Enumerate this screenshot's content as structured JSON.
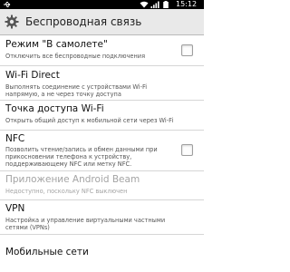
{
  "status_bar": {
    "time": "15:12",
    "icons": [
      "usb-icon",
      "wifi-icon",
      "signal-icon",
      "battery-icon"
    ]
  },
  "header": {
    "title": "Беспроводная связь",
    "icon": "gear-icon"
  },
  "settings": [
    {
      "title": "Режим \"В самолете\"",
      "summary": "Отключить все беспроводные подключения",
      "checkbox": true,
      "checked": false,
      "enabled": true
    },
    {
      "title": "Wi-Fi Direct",
      "summary": "Выполнять соединение  с устройствами Wi-Fi напрямую, а не через точку доступа",
      "checkbox": false,
      "enabled": true
    },
    {
      "title": "Точка доступа Wi-Fi",
      "summary": "Открыть общий доступ к мобильной сети через Wi-Fi",
      "checkbox": false,
      "enabled": true
    },
    {
      "title": "NFC",
      "summary": "Позволить чтение/запись и обмен данными при прикосновении телефона к устройству, поддерживающему NFC или метку NFC.",
      "checkbox": true,
      "checked": false,
      "enabled": true
    },
    {
      "title": "Приложение Android Beam",
      "summary": "Недоступно, поскольку NFC выключен",
      "checkbox": false,
      "enabled": false
    },
    {
      "title": "VPN",
      "summary": "Настройка и управление виртуальными частными сетями (VPNs)",
      "checkbox": false,
      "enabled": true
    },
    {
      "title": "Мобильные сети",
      "summary": "",
      "checkbox": false,
      "enabled": true
    }
  ]
}
